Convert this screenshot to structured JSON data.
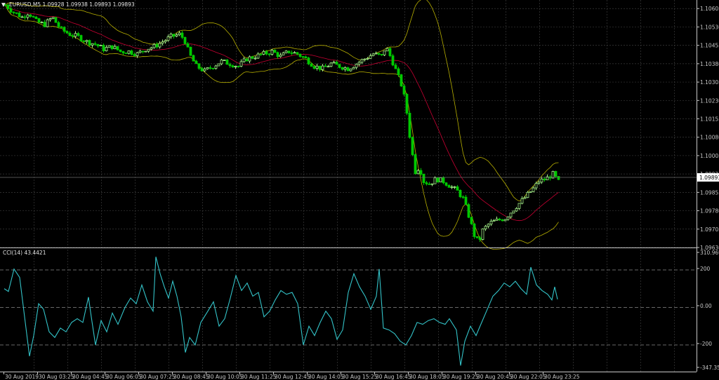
{
  "main": {
    "title": "EURUSD,M5  1.09928 1.09938 1.09893 1.09893",
    "arrow_icon": "down-triangle-icon"
  },
  "colors": {
    "background": "#000000",
    "grid": "#3a3a3a",
    "bull_candle": "#a6f28a",
    "bear_candle": "#00c800",
    "bb_outer": "#b8b000",
    "bb_middle": "#c80032",
    "cci_line": "#33c3c8",
    "axis_text": "#c8c8c8"
  },
  "chart_data": [
    {
      "type": "candlestick",
      "title": "EURUSD,M5  1.09928 1.09938 1.09893 1.09893",
      "symbol": "EURUSD",
      "timeframe": "M5",
      "ohlc_last": {
        "open": 1.09928,
        "high": 1.09938,
        "low": 1.09893,
        "close": 1.09893
      },
      "current_price_label": "1.09893",
      "ylim": [
        1.0963,
        1.1064
      ],
      "y_ticks": [
        "1.10605",
        "1.10530",
        "1.10455",
        "1.10380",
        "1.10305",
        "1.10230",
        "1.10155",
        "1.10080",
        "1.10005",
        "1.09930",
        "1.09855",
        "1.09780",
        "1.09705",
        "1.09630"
      ],
      "grid": true,
      "overlays": [
        "Bollinger Bands (upper / middle / lower)"
      ],
      "close_points": [
        [
          0,
          1.1062
        ],
        [
          12,
          1.1059
        ],
        [
          24,
          1.1057
        ],
        [
          33,
          1.1059
        ],
        [
          45,
          1.1055
        ],
        [
          56,
          1.1054
        ],
        [
          67,
          1.1057
        ],
        [
          79,
          1.1052
        ],
        [
          92,
          1.105
        ],
        [
          104,
          1.1049
        ],
        [
          116,
          1.1047
        ],
        [
          128,
          1.1046
        ],
        [
          140,
          1.1044
        ],
        [
          152,
          1.1045
        ],
        [
          164,
          1.1043
        ],
        [
          176,
          1.1043
        ],
        [
          188,
          1.1042
        ],
        [
          200,
          1.1044
        ],
        [
          212,
          1.1045
        ],
        [
          224,
          1.1047
        ],
        [
          236,
          1.1049
        ],
        [
          248,
          1.105
        ],
        [
          255,
          1.1048
        ],
        [
          262,
          1.1042
        ],
        [
          272,
          1.1037
        ],
        [
          284,
          1.1035
        ],
        [
          296,
          1.1037
        ],
        [
          308,
          1.1039
        ],
        [
          320,
          1.1038
        ],
        [
          332,
          1.1037
        ],
        [
          344,
          1.104
        ],
        [
          356,
          1.1041
        ],
        [
          368,
          1.1042
        ],
        [
          380,
          1.1043
        ],
        [
          392,
          1.1041
        ],
        [
          404,
          1.1043
        ],
        [
          416,
          1.1042
        ],
        [
          428,
          1.104
        ],
        [
          440,
          1.1037
        ],
        [
          452,
          1.1036
        ],
        [
          464,
          1.1038
        ],
        [
          476,
          1.1037
        ],
        [
          488,
          1.1036
        ],
        [
          500,
          1.1038
        ],
        [
          512,
          1.104
        ],
        [
          524,
          1.1042
        ],
        [
          536,
          1.1041
        ],
        [
          542,
          1.1045
        ],
        [
          550,
          1.104
        ],
        [
          558,
          1.1034
        ],
        [
          566,
          1.1028
        ],
        [
          572,
          1.1018
        ],
        [
          578,
          1.1004
        ],
        [
          584,
          1.0994
        ],
        [
          590,
          1.0996
        ],
        [
          596,
          1.099
        ],
        [
          604,
          1.0989
        ],
        [
          614,
          1.0991
        ],
        [
          624,
          1.099
        ],
        [
          634,
          1.0988
        ],
        [
          644,
          1.0986
        ],
        [
          652,
          1.0983
        ],
        [
          660,
          1.0976
        ],
        [
          668,
          1.0968
        ],
        [
          674,
          1.0965
        ],
        [
          680,
          1.097
        ],
        [
          690,
          1.0973
        ],
        [
          700,
          1.0974
        ],
        [
          712,
          1.0975
        ],
        [
          722,
          1.0978
        ],
        [
          732,
          1.0981
        ],
        [
          742,
          1.0984
        ],
        [
          752,
          1.0987
        ],
        [
          760,
          1.099
        ],
        [
          770,
          1.0991
        ],
        [
          780,
          1.0993
        ],
        [
          790,
          1.0989
        ]
      ]
    },
    {
      "type": "line",
      "title": "CCI(14) 43.4421",
      "indicator": "CCI(14)",
      "last_value": 43.4421,
      "ylim": [
        -347.3508,
        310.9694
      ],
      "y_ticks": [
        "310.9694",
        "200",
        "0.00",
        "-200",
        "-347.3508"
      ],
      "levels": [
        200,
        0,
        -200
      ],
      "series": [
        {
          "values": [
            [
              6,
              100
            ],
            [
              12,
              85
            ],
            [
              20,
              205
            ],
            [
              28,
              160
            ],
            [
              34,
              -20
            ],
            [
              42,
              -260
            ],
            [
              48,
              -150
            ],
            [
              55,
              20
            ],
            [
              62,
              -10
            ],
            [
              70,
              -130
            ],
            [
              78,
              -160
            ],
            [
              86,
              -110
            ],
            [
              94,
              -130
            ],
            [
              102,
              -80
            ],
            [
              110,
              -60
            ],
            [
              118,
              -80
            ],
            [
              126,
              55
            ],
            [
              130,
              -50
            ],
            [
              136,
              -200
            ],
            [
              144,
              -70
            ],
            [
              152,
              -130
            ],
            [
              160,
              -30
            ],
            [
              168,
              -90
            ],
            [
              178,
              0
            ],
            [
              186,
              50
            ],
            [
              194,
              20
            ],
            [
              202,
              120
            ],
            [
              210,
              30
            ],
            [
              218,
              -20
            ],
            [
              222,
              270
            ],
            [
              228,
              180
            ],
            [
              234,
              110
            ],
            [
              240,
              50
            ],
            [
              246,
              140
            ],
            [
              252,
              60
            ],
            [
              258,
              -50
            ],
            [
              264,
              -240
            ],
            [
              270,
              -160
            ],
            [
              278,
              -200
            ],
            [
              286,
              -80
            ],
            [
              296,
              -20
            ],
            [
              304,
              30
            ],
            [
              312,
              -100
            ],
            [
              320,
              -60
            ],
            [
              328,
              50
            ],
            [
              336,
              170
            ],
            [
              344,
              90
            ],
            [
              352,
              130
            ],
            [
              360,
              60
            ],
            [
              368,
              80
            ],
            [
              376,
              -50
            ],
            [
              384,
              -20
            ],
            [
              392,
              40
            ],
            [
              400,
              90
            ],
            [
              408,
              70
            ],
            [
              416,
              80
            ],
            [
              424,
              20
            ],
            [
              432,
              -200
            ],
            [
              440,
              -100
            ],
            [
              448,
              -150
            ],
            [
              456,
              -80
            ],
            [
              464,
              -20
            ],
            [
              472,
              -60
            ],
            [
              480,
              -170
            ],
            [
              488,
              -120
            ],
            [
              496,
              80
            ],
            [
              504,
              180
            ],
            [
              512,
              110
            ],
            [
              520,
              60
            ],
            [
              528,
              -10
            ],
            [
              536,
              60
            ],
            [
              540,
              205
            ],
            [
              546,
              -110
            ],
            [
              554,
              -120
            ],
            [
              562,
              -140
            ],
            [
              570,
              -180
            ],
            [
              578,
              -200
            ],
            [
              586,
              -150
            ],
            [
              594,
              -80
            ],
            [
              602,
              -90
            ],
            [
              610,
              -70
            ],
            [
              618,
              -60
            ],
            [
              626,
              -80
            ],
            [
              634,
              -90
            ],
            [
              640,
              -60
            ],
            [
              650,
              -120
            ],
            [
              656,
              -310
            ],
            [
              662,
              -180
            ],
            [
              670,
              -100
            ],
            [
              678,
              -150
            ],
            [
              686,
              -80
            ],
            [
              694,
              -10
            ],
            [
              702,
              60
            ],
            [
              710,
              90
            ],
            [
              718,
              130
            ],
            [
              726,
              110
            ],
            [
              734,
              140
            ],
            [
              742,
              100
            ],
            [
              750,
              70
            ],
            [
              756,
              215
            ],
            [
              764,
              120
            ],
            [
              772,
              90
            ],
            [
              780,
              70
            ],
            [
              786,
              40
            ],
            [
              790,
              110
            ],
            [
              794,
              43
            ]
          ]
        }
      ]
    }
  ],
  "sub": {
    "title": "CCI(14) 43.4421"
  },
  "x_axis": {
    "labels": [
      "30 Aug 2019",
      "30 Aug 03:25",
      "30 Aug 04:45",
      "30 Aug 06:05",
      "30 Aug 07:25",
      "30 Aug 08:45",
      "30 Aug 10:05",
      "30 Aug 11:25",
      "30 Aug 12:45",
      "30 Aug 14:05",
      "30 Aug 15:25",
      "30 Aug 16:45",
      "30 Aug 18:05",
      "30 Aug 19:25",
      "30 Aug 20:45",
      "30 Aug 22:05",
      "30 Aug 23:25"
    ]
  }
}
